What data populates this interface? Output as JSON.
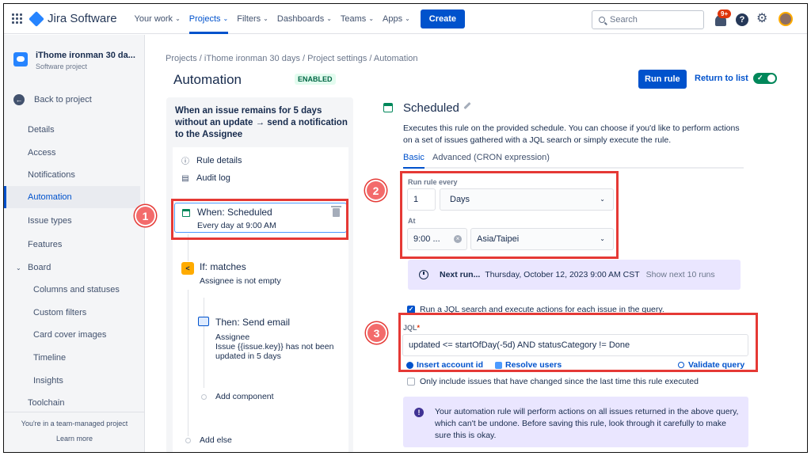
{
  "topnav": {
    "logo": "Jira Software",
    "items": [
      {
        "label": "Your work"
      },
      {
        "label": "Projects"
      },
      {
        "label": "Filters"
      },
      {
        "label": "Dashboards"
      },
      {
        "label": "Teams"
      },
      {
        "label": "Apps"
      }
    ],
    "create_label": "Create",
    "search_placeholder": "Search",
    "notif_count": "9+",
    "help_glyph": "?"
  },
  "sidebar": {
    "project_name": "iThome ironman 30 da...",
    "project_type": "Software project",
    "back_label": "Back to project",
    "items": [
      {
        "label": "Details"
      },
      {
        "label": "Access"
      },
      {
        "label": "Notifications"
      },
      {
        "label": "Automation"
      },
      {
        "label": "Issue types"
      },
      {
        "label": "Features"
      },
      {
        "label": "Board"
      },
      {
        "label": "Columns and statuses"
      },
      {
        "label": "Custom filters"
      },
      {
        "label": "Card cover images"
      },
      {
        "label": "Timeline"
      },
      {
        "label": "Insights"
      },
      {
        "label": "Toolchain"
      }
    ],
    "footer_text": "You're in a team-managed project",
    "learn_more": "Learn more"
  },
  "main": {
    "breadcrumb": "Projects  /  iThome ironman 30 days  /  Project settings  /  Automation",
    "title": "Automation",
    "status": "ENABLED",
    "run_rule": "Run rule",
    "return_to_list": "Return to list"
  },
  "rule": {
    "summary": "When an issue remains for 5 days without an update → send a notification to the Assignee",
    "rule_details": "Rule details",
    "audit_log": "Audit log",
    "trigger_title": "When: Scheduled",
    "trigger_sub": "Every day at 9:00 AM",
    "condition_title": "If: matches",
    "condition_sub": "Assignee is not empty",
    "action_title": "Then: Send email",
    "action_line1": "Assignee",
    "action_line2": "Issue {{issue.key}} has not been updated in 5 days",
    "add_component": "Add component",
    "add_else": "Add else"
  },
  "config": {
    "title": "Scheduled",
    "description": "Executes this rule on the provided schedule. You can choose if you'd like to perform actions on a set of issues gathered with a JQL search or simply execute the rule.",
    "tab_basic": "Basic",
    "tab_advanced": "Advanced (CRON expression)",
    "run_every_label": "Run rule every",
    "run_every_value": "1",
    "run_every_unit": "Days",
    "at_label": "At",
    "time_value": "9:00 ...",
    "timezone": "Asia/Taipei",
    "next_run_label": "Next run...",
    "next_run_value": "Thursday, October 12, 2023 9:00 AM CST",
    "show_next": "Show next 10 runs",
    "jql_checkbox_label": "Run a JQL search and execute actions for each issue in the query.",
    "jql_label": "JQL",
    "jql_required": "*",
    "jql_value": "updated <= startOfDay(-5d) AND statusCategory != Done",
    "insert_account": "Insert account id",
    "resolve_users": "Resolve users",
    "validate_query": "Validate query",
    "only_changed_label": "Only include issues that have changed since the last time this rule executed",
    "warning": "Your automation rule will perform actions on all issues returned in the above query, which can't be undone. Before saving this rule, look through it carefully to make sure this is okay."
  },
  "annotations": {
    "badge1": "1",
    "badge2": "2",
    "badge3": "3"
  },
  "colors": {
    "accent": "#0052cc",
    "highlight": "#e53935",
    "success": "#00875a"
  }
}
